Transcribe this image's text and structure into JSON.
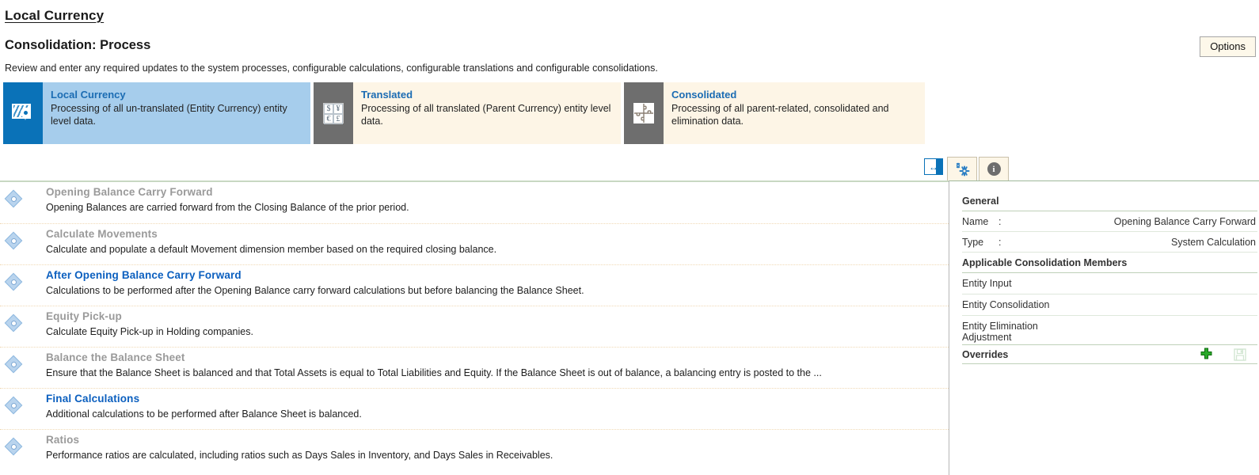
{
  "header": {
    "breadcrumb": "Local Currency",
    "page_title": "Consolidation: Process",
    "description": "Review and enter any required updates to the system processes, configurable calculations, configurable translations and configurable consolidations.",
    "options_label": "Options"
  },
  "cards": [
    {
      "title": "Local Currency",
      "desc": "Processing of all un-translated (Entity Currency) entity level data.",
      "icon": "map-pin-icon",
      "state": "active",
      "accent": "#0a72b8",
      "body_bg": "#a6cdec"
    },
    {
      "title": "Translated",
      "desc": "Processing of all translated (Parent Currency) entity level data.",
      "icon": "currency-grid-icon",
      "state": "idle",
      "accent": "#6e6e6e",
      "body_bg": "#fdf5e6"
    },
    {
      "title": "Consolidated",
      "desc": "Processing of all parent-related, consolidated and elimination data.",
      "icon": "puzzle-piece-icon",
      "state": "idle",
      "accent": "#6e6e6e",
      "body_bg": "#fdf5e6"
    }
  ],
  "process_list": [
    {
      "title": "Opening Balance Carry Forward",
      "desc": "Opening Balances are carried forward from the Closing Balance of the prior period.",
      "style": "muted"
    },
    {
      "title": "Calculate Movements",
      "desc": "Calculate and populate a default Movement dimension member based on the required closing balance.",
      "style": "muted"
    },
    {
      "title": "After Opening Balance Carry Forward",
      "desc": "Calculations to be performed after the Opening Balance carry forward calculations but before balancing the Balance Sheet.",
      "style": "linked"
    },
    {
      "title": "Equity Pick-up",
      "desc": "Calculate Equity Pick-up in Holding companies.",
      "style": "muted"
    },
    {
      "title": "Balance the Balance Sheet",
      "desc": "Ensure that the Balance Sheet is balanced and that Total Assets is equal to Total Liabilities and Equity. If the Balance Sheet is out of balance, a balancing entry is posted to the ...",
      "style": "muted"
    },
    {
      "title": "Final Calculations",
      "desc": "Additional calculations to be performed after Balance Sheet is balanced.",
      "style": "linked"
    },
    {
      "title": "Ratios",
      "desc": "Performance ratios are calculated, including ratios such as Days Sales in Inventory, and Days Sales in Receivables.",
      "style": "muted"
    }
  ],
  "panel": {
    "tabs": [
      {
        "icon": "gear-icon",
        "selected": true
      },
      {
        "icon": "info-icon",
        "selected": false
      }
    ],
    "expander_icon": "expand-panel-icon",
    "general_heading": "General",
    "fields": [
      {
        "key": "Name",
        "colon": ":",
        "value": "Opening Balance Carry Forward"
      },
      {
        "key": "Type",
        "colon": ":",
        "value": "System Calculation"
      }
    ],
    "members_heading": "Applicable Consolidation Members",
    "members": [
      "Entity Input",
      "Entity Consolidation",
      "Entity Elimination\nAdjustment"
    ],
    "overrides_label": "Overrides",
    "add_icon": "plus-icon",
    "save_icon": "save-icon",
    "add_color": "#2aa82a",
    "save_color": "#9dc89d"
  }
}
